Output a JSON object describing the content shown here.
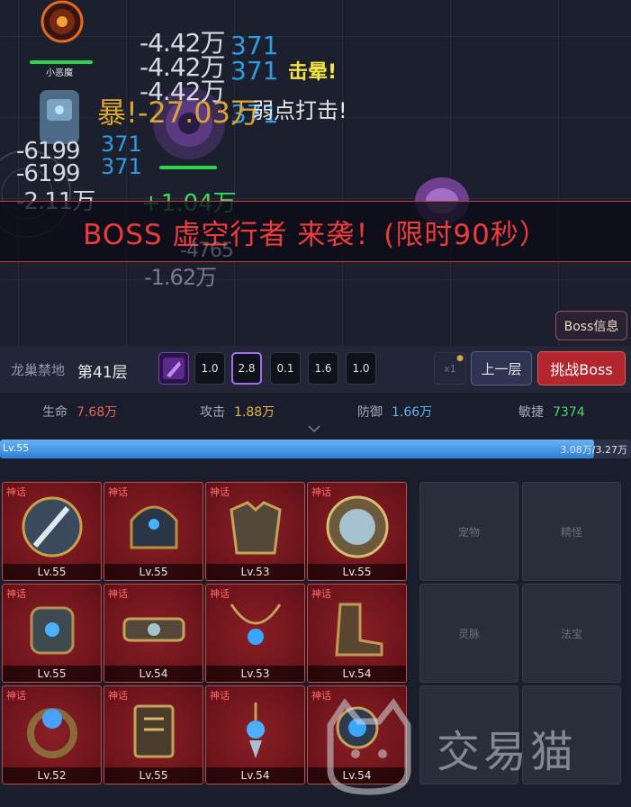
{
  "battle": {
    "ally_name": "小恶魔",
    "damage_numbers": [
      "-4.42万",
      "-4.42万",
      "-4.42万"
    ],
    "blue_numbers": [
      "371",
      "371",
      "371"
    ],
    "crit_text": "暴!-27.03万",
    "stun_text": "击晕!",
    "weak_text": "弱点打击!",
    "left_numbers": [
      "-6199",
      "-6199",
      "-2.11万"
    ],
    "left_blue": [
      "371",
      "371"
    ],
    "heal_text": "+1.04万",
    "faded_numbers": [
      "-4765",
      "-1.62万"
    ],
    "boss_banner": "BOSS 虚空行者 来袭！(限时90秒）",
    "boss_info_button": "Boss信息"
  },
  "level_bar": {
    "zone_name": "龙巢禁地",
    "floor": "第41层",
    "speed_slots": [
      "1.0",
      "2.8",
      "0.1",
      "1.6",
      "1.0"
    ],
    "selected_slot_index": 1,
    "lock_slot_label": "x1",
    "prev_floor_button": "上一层",
    "challenge_button": "挑战Boss"
  },
  "stats": {
    "hp_label": "生命",
    "hp_value": "7.68万",
    "atk_label": "攻击",
    "atk_value": "1.88万",
    "def_label": "防御",
    "def_value": "1.66万",
    "agi_label": "敏捷",
    "agi_value": "7374"
  },
  "exp": {
    "level": "Lv.55",
    "current": "3.08万",
    "total": "3.27万",
    "display": "3.08万/3.27万",
    "fraction": 0.942
  },
  "equipment": [
    {
      "tag": "神话",
      "level": "Lv.55",
      "icon": "sword-shield-icon"
    },
    {
      "tag": "神话",
      "level": "Lv.55",
      "icon": "helmet-icon"
    },
    {
      "tag": "神话",
      "level": "Lv.53",
      "icon": "armor-icon"
    },
    {
      "tag": "神话",
      "level": "Lv.55",
      "icon": "round-shield-icon"
    },
    {
      "tag": "神话",
      "level": "Lv.55",
      "icon": "bracer-icon"
    },
    {
      "tag": "神话",
      "level": "Lv.54",
      "icon": "belt-icon"
    },
    {
      "tag": "神话",
      "level": "Lv.53",
      "icon": "necklace-icon"
    },
    {
      "tag": "神话",
      "level": "Lv.54",
      "icon": "boots-icon"
    },
    {
      "tag": "神话",
      "level": "Lv.52",
      "icon": "ring-icon"
    },
    {
      "tag": "神话",
      "level": "Lv.55",
      "icon": "talisman-icon"
    },
    {
      "tag": "神话",
      "level": "Lv.54",
      "icon": "earring-icon"
    },
    {
      "tag": "神话",
      "level": "Lv.54",
      "icon": "pendant-icon"
    }
  ],
  "side_slots": [
    "宠物",
    "精怪",
    "灵脉",
    "法宝",
    "",
    ""
  ],
  "watermark": {
    "text": "交易猫"
  },
  "colors": {
    "hp_value": "#e8615c",
    "atk_value": "#e9b24a",
    "def_value": "#5fb5ef",
    "agi_value": "#4fd56f",
    "banner_red": "#ee3b3b",
    "equip_red": "#7a1a21"
  }
}
